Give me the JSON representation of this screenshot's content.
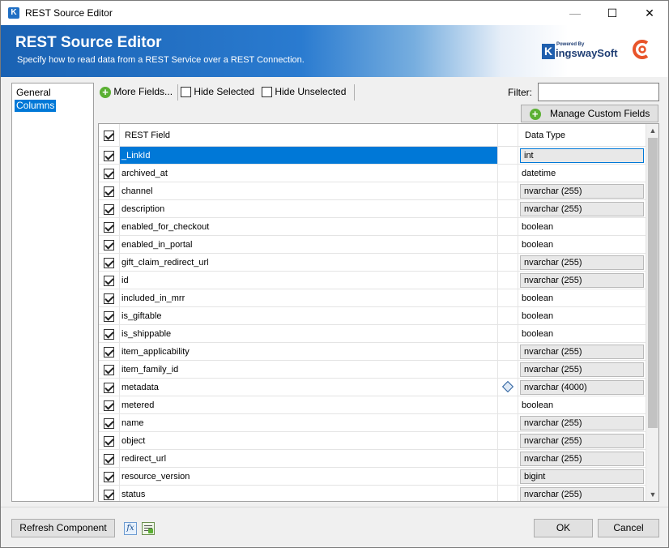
{
  "window": {
    "title": "REST Source Editor",
    "app_icon": "K",
    "minimize": "—",
    "maximize": "☐",
    "close": "✕"
  },
  "header": {
    "title": "REST Source Editor",
    "subtitle": "Specify how to read data from a REST Service over a REST Connection.",
    "logo_small": "Powered By",
    "logo_k": "K",
    "logo_text": "ingswaySoft"
  },
  "nav": {
    "items": [
      {
        "label": "General"
      },
      {
        "label": "Columns"
      }
    ]
  },
  "toolbar": {
    "more_fields": "More Fields...",
    "hide_selected": "Hide Selected",
    "hide_unselected": "Hide Unselected",
    "filter_label": "Filter:",
    "filter_value": ""
  },
  "manage_custom_fields": "Manage Custom Fields",
  "grid": {
    "headers": {
      "field": "REST Field",
      "type": "Data Type"
    },
    "rows": [
      {
        "field": "_LinkId",
        "type": "int",
        "boxed": true,
        "selected": true
      },
      {
        "field": "archived_at",
        "type": "datetime",
        "boxed": false
      },
      {
        "field": "channel",
        "type": "nvarchar (255)",
        "boxed": true
      },
      {
        "field": "description",
        "type": "nvarchar (255)",
        "boxed": true
      },
      {
        "field": "enabled_for_checkout",
        "type": "boolean",
        "boxed": false
      },
      {
        "field": "enabled_in_portal",
        "type": "boolean",
        "boxed": false
      },
      {
        "field": "gift_claim_redirect_url",
        "type": "nvarchar (255)",
        "boxed": true
      },
      {
        "field": "id",
        "type": "nvarchar (255)",
        "boxed": true
      },
      {
        "field": "included_in_mrr",
        "type": "boolean",
        "boxed": false
      },
      {
        "field": "is_giftable",
        "type": "boolean",
        "boxed": false
      },
      {
        "field": "is_shippable",
        "type": "boolean",
        "boxed": false
      },
      {
        "field": "item_applicability",
        "type": "nvarchar (255)",
        "boxed": true
      },
      {
        "field": "item_family_id",
        "type": "nvarchar (255)",
        "boxed": true
      },
      {
        "field": "metadata",
        "type": "nvarchar (4000)",
        "boxed": true,
        "icon": "diamond-icon"
      },
      {
        "field": "metered",
        "type": "boolean",
        "boxed": false
      },
      {
        "field": "name",
        "type": "nvarchar (255)",
        "boxed": true
      },
      {
        "field": "object",
        "type": "nvarchar (255)",
        "boxed": true
      },
      {
        "field": "redirect_url",
        "type": "nvarchar (255)",
        "boxed": true
      },
      {
        "field": "resource_version",
        "type": "bigint",
        "boxed": true
      },
      {
        "field": "status",
        "type": "nvarchar (255)",
        "boxed": true
      }
    ]
  },
  "footer": {
    "refresh": "Refresh Component",
    "fx": "fx",
    "ok": "OK",
    "cancel": "Cancel"
  },
  "colors": {
    "accent": "#0078d7",
    "header_blue": "#1a62b3",
    "plus_green": "#5bb033",
    "brand_orange": "#e8542a"
  }
}
